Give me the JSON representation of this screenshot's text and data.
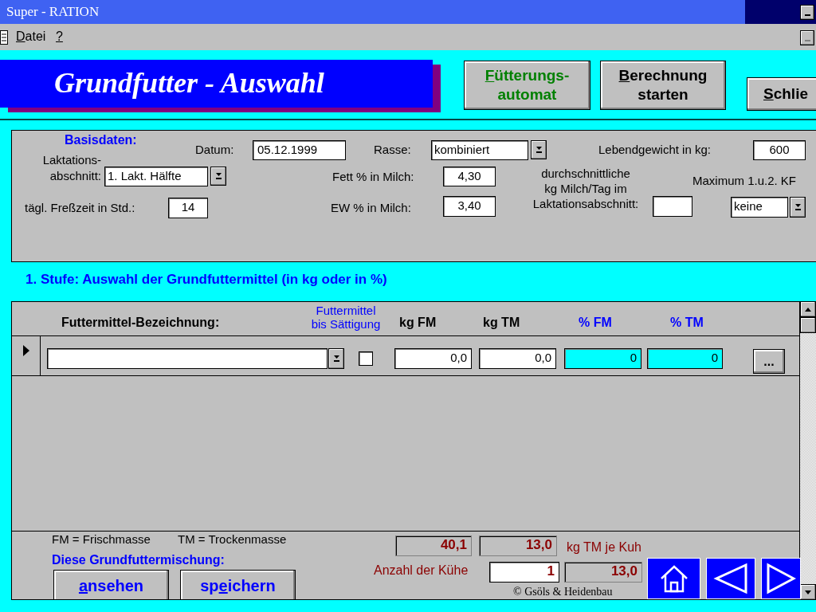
{
  "window": {
    "title": "Super - RATION"
  },
  "menu": [
    {
      "key": "D",
      "post": "atei"
    },
    {
      "key": "?"
    }
  ],
  "header": {
    "title": "Grundfutter - Auswahl",
    "buttons": [
      {
        "kind": "green",
        "lines": [
          {
            "key": "F",
            "post": "ütterungs-"
          },
          {
            "pre": "automat"
          }
        ]
      },
      {
        "kind": "plain",
        "lines": [
          {
            "key": "B",
            "post": "erechnung"
          },
          {
            "pre": "starten"
          }
        ]
      },
      {
        "kind": "plain",
        "lines": [
          {
            "key": "S",
            "post": "chlie"
          }
        ]
      }
    ]
  },
  "basisdaten": {
    "title": "Basisdaten:",
    "datum": {
      "label": "Datum:",
      "value": "05.12.1999"
    },
    "rasse": {
      "label": "Rasse:",
      "value": "kombiniert"
    },
    "lebendgewicht": {
      "label": "Lebendgewicht in kg:",
      "value": "600"
    },
    "laktationsabschnitt": {
      "label": "Laktations-\nabschnitt:",
      "value": "1. Lakt. Hälfte"
    },
    "fett": {
      "label": "Fett % in Milch:",
      "value": "4,30"
    },
    "milch": {
      "label": "durchschnittliche\nkg Milch/Tag im\nLaktationsabschnitt:"
    },
    "maximum": {
      "label": "Maximum 1.u.2. KF",
      "value": "keine"
    },
    "fresszeit": {
      "label": "tägl. Freßzeit in Std.:",
      "value": "14"
    },
    "ew": {
      "label": "EW % in Milch:",
      "value": "3,40"
    }
  },
  "stufe_title": "1. Stufe:  Auswahl der Grundfuttermittel (in kg oder in %)",
  "table": {
    "columns": [
      {
        "label": "Futtermittel-Bezeichnung:",
        "kind": "bold"
      },
      {
        "label": "Futtermittel\nbis Sättigung",
        "kind": "blue-small"
      },
      {
        "label": "kg FM",
        "kind": "bold"
      },
      {
        "label": "kg TM",
        "kind": "bold"
      },
      {
        "label": "% FM",
        "kind": "blue"
      },
      {
        "label": "% TM",
        "kind": "blue"
      }
    ],
    "rows": [
      {
        "selected": true,
        "saturation": false,
        "kg_fm": "0,0",
        "kg_tm": "0,0",
        "pct_fm": "0",
        "pct_tm": "0",
        "more": "..."
      }
    ]
  },
  "footer": {
    "legend": [
      "FM = Frischmasse",
      "TM = Trockenmasse"
    ],
    "mix_label": "Diese Grundfuttermischung:",
    "buttons": [
      {
        "key": "a",
        "post": "nsehen"
      },
      {
        "pre": "sp",
        "key": "e",
        "post": "ichern"
      }
    ],
    "total_fm": "40,1",
    "total_tm": "13,0",
    "unit": "kg TM je Kuh",
    "cows_label": "Anzahl der Kühe",
    "cows": "1",
    "cows_tm": "13,0",
    "copyright": "© Gsöls & Heidenbau"
  },
  "nav": [
    {
      "kind": "home"
    },
    {
      "kind": "back"
    },
    {
      "kind": "forward"
    }
  ]
}
